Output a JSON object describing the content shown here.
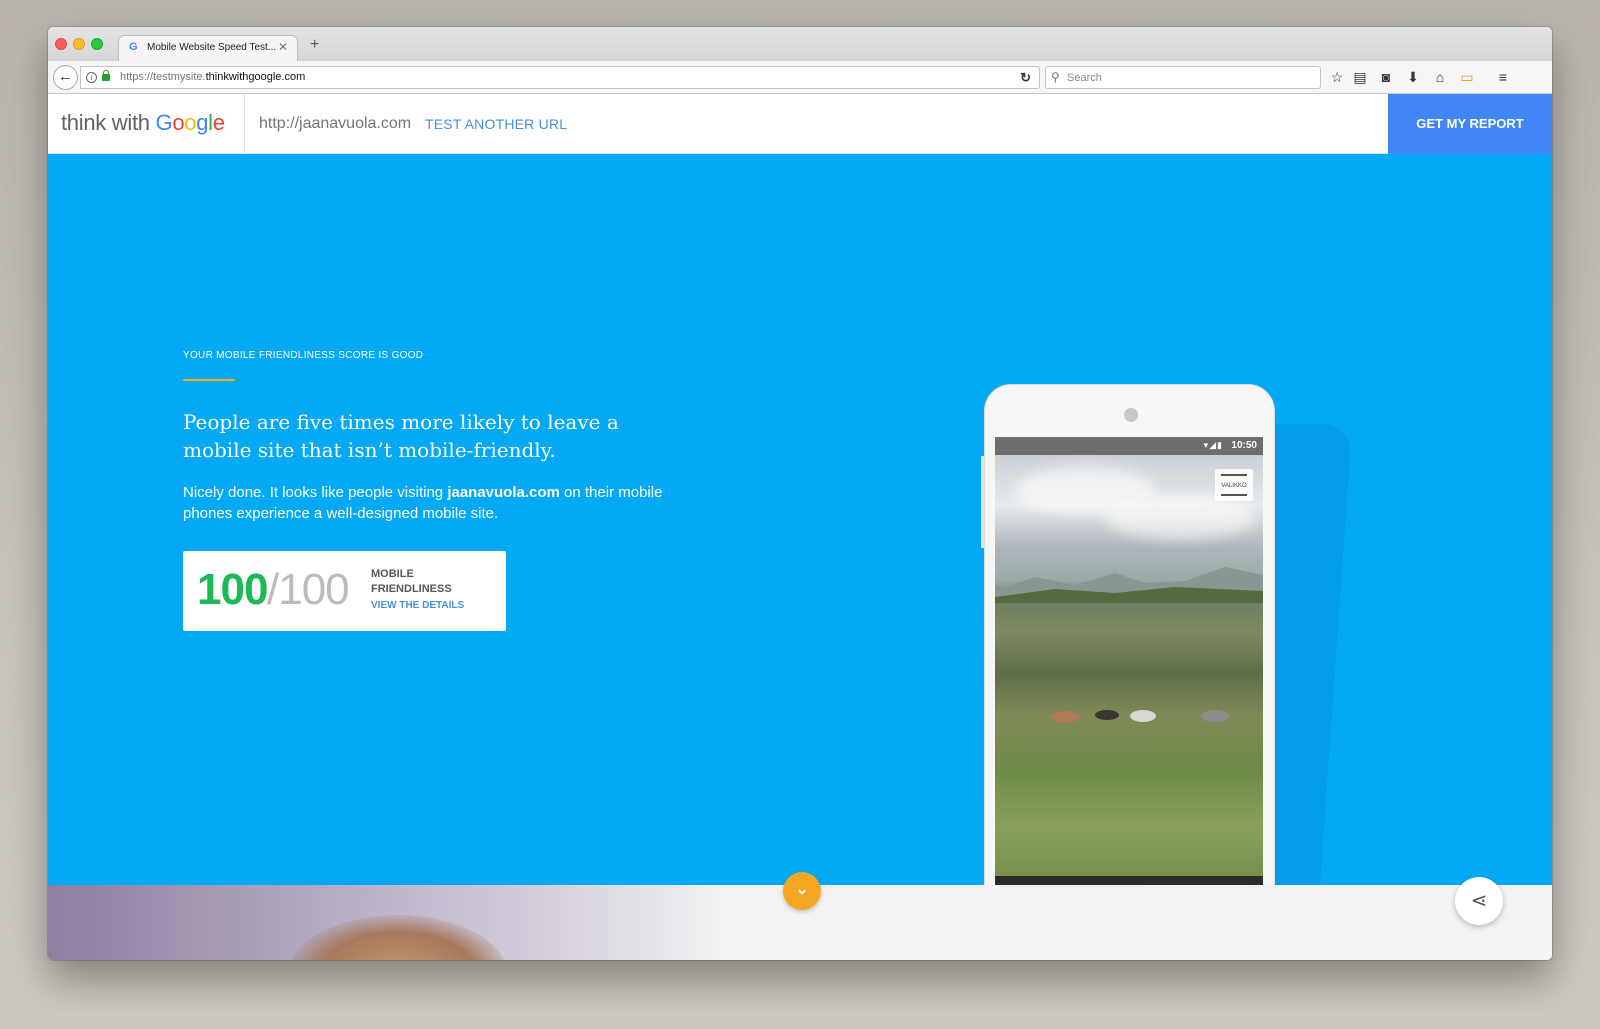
{
  "browser": {
    "tab": {
      "title": "Mobile Website Speed Test...",
      "favicon": "G"
    },
    "url": {
      "prefix": "https://testmysite.",
      "domain": "thinkwithgoogle.com"
    },
    "search_placeholder": "Search",
    "icons": [
      "back-icon",
      "info-icon",
      "lock-icon",
      "reload-icon",
      "search-icon",
      "bookmark-star-icon",
      "reading-list-icon",
      "pocket-icon",
      "download-icon",
      "home-icon",
      "extension-icon",
      "menu-icon"
    ]
  },
  "header": {
    "logo_prefix": "think with ",
    "logo_google": [
      "G",
      "o",
      "o",
      "g",
      "l",
      "e"
    ],
    "tested_url": "http://jaanavuola.com",
    "test_another": "TEST ANOTHER URL",
    "get_report": "GET MY REPORT"
  },
  "hero": {
    "eyebrow": "YOUR MOBILE FRIENDLINESS SCORE IS GOOD",
    "headline": "People are five times more likely to leave a mobile site that isn’t mobile-friendly.",
    "body_prefix": "Nicely done. It looks like people visiting ",
    "body_site": "jaanavuola.com",
    "body_suffix": " on their mobile phones experience a well-designed mobile site.",
    "score": {
      "value": "100",
      "denominator": "/100",
      "label": "MOBILE FRIENDLINESS",
      "details_link": "VIEW THE DETAILS"
    }
  },
  "phone": {
    "time": "10:50",
    "menu_label": "VALIKKO"
  },
  "colors": {
    "hero_bg": "#03a9f4",
    "report_button": "#4285f4",
    "score_green": "#1db954",
    "scroll_button": "#f5a623"
  }
}
